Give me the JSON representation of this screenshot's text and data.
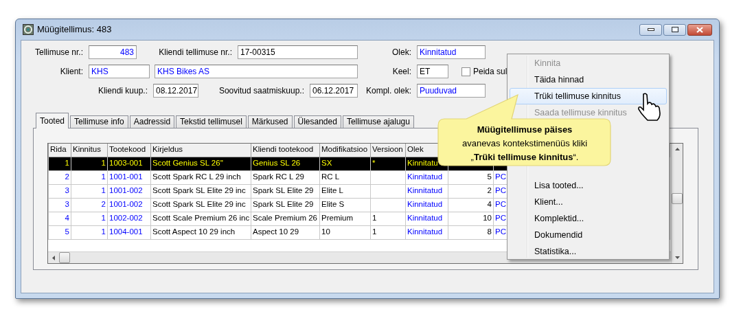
{
  "window": {
    "title": "Müügitellimus: 483"
  },
  "form_rows": [
    [
      {
        "label": "Tellimuse nr.:",
        "value": "483",
        "color": "#0000ff"
      },
      {
        "label": "Kliendi tellimuse nr.:",
        "value": "17-00315",
        "color": "#000000"
      },
      {
        "label": "Olek:",
        "value": "Kinnitatud",
        "color": "#0000ff"
      }
    ],
    [
      {
        "label": "Klient:",
        "value": "KHS",
        "color": "#0000ff"
      },
      {
        "value": "KHS Bikes AS",
        "color": "#0000ff"
      },
      {
        "label": "Keel:",
        "value": "ET",
        "color": "#000000"
      }
    ],
    [
      {
        "label": "Kliendi kuup.:",
        "value": "08.12.2017",
        "color": "#000000"
      },
      {
        "label": "Soovitud saatmiskuup.:",
        "value": "06.12.2017",
        "color": "#000000"
      },
      {
        "label": "Kompl. olek:",
        "value": "Puuduvad",
        "color": "#0000ff"
      }
    ]
  ],
  "checkbox": {
    "label": "Peida sul",
    "checked": false
  },
  "tabs": [
    {
      "label": "Tooted",
      "selected": true
    },
    {
      "label": "Tellimuse info",
      "selected": false
    },
    {
      "label": "Aadressid",
      "selected": false
    },
    {
      "label": "Tekstid tellimusel",
      "selected": false
    },
    {
      "label": "Märkused",
      "selected": false
    },
    {
      "label": "Ülesanded",
      "selected": false
    },
    {
      "label": "Tellimuse ajalugu",
      "selected": false
    }
  ],
  "table": {
    "columns": [
      "Rida",
      "Kinnitus",
      "Tootekood",
      "Kirjeldus",
      "Kliendi tootekood",
      "Modifikatsioo",
      "Versioon",
      "Olek"
    ],
    "rows": [
      {
        "selected": true,
        "cells": [
          "1",
          "1",
          "1003-001",
          "Scott Genius SL 26''",
          "Genius SL 26",
          "SX",
          "*",
          "Kinnitatu"
        ]
      },
      {
        "selected": false,
        "cells": [
          "2",
          "1",
          "1001-001",
          "Scott Spark RC L 29 inch",
          "Spark RC L 29",
          "RC L",
          null,
          "Kinnitatud",
          "5",
          "PC"
        ]
      },
      {
        "selected": false,
        "cells": [
          "3",
          "1",
          "1001-002",
          "Scott Spark SL Elite 29 inc",
          "Spark SL Elite 29",
          "Elite L",
          null,
          "Kinnitatud",
          "2",
          "PC"
        ]
      },
      {
        "selected": false,
        "cells": [
          "3",
          "2",
          "1001-002",
          "Scott Spark SL Elite 29 inc",
          "Spark SL Elite 29",
          "Elite S",
          null,
          "Kinnitatud",
          "4",
          "PC"
        ]
      },
      {
        "selected": false,
        "cells": [
          "4",
          "1",
          "1002-002",
          "Scott Scale Premium 26 inc",
          "Scale Premium 26",
          "Premium",
          "1",
          "Kinnitatud",
          "10",
          "PC"
        ]
      },
      {
        "selected": false,
        "cells": [
          "5",
          "1",
          "1004-001",
          "Scott Aspect 10 29 inch",
          "Aspect 10 29",
          "10",
          "1",
          "Kinnitatud",
          "8",
          "PC"
        ]
      }
    ]
  },
  "context_menu": {
    "groups": [
      [
        {
          "label": "Kinnita",
          "disabled": true,
          "selected": false
        },
        {
          "label": "Täida hinnad",
          "disabled": false,
          "selected": false
        },
        {
          "label": "Trüki tellimuse kinnitus",
          "disabled": false,
          "selected": true
        },
        {
          "label": "Saada tellimuse kinnitus",
          "disabled": true,
          "selected": false
        }
      ],
      [
        {
          "label": "Lisa tooted...",
          "disabled": false,
          "selected": false
        },
        {
          "label": "Klient...",
          "disabled": false,
          "selected": false
        },
        {
          "label": "Komplektid...",
          "disabled": false,
          "selected": false
        },
        {
          "label": "Dokumendid",
          "disabled": false,
          "selected": false
        },
        {
          "label": "Statistika...",
          "disabled": false,
          "selected": false
        }
      ]
    ]
  },
  "callout": {
    "lines": [
      "Müügitellimuse päises",
      "avanevas kontekstimenüüs kliki",
      "„**Trüki tellimuse kinnitus**“."
    ]
  }
}
